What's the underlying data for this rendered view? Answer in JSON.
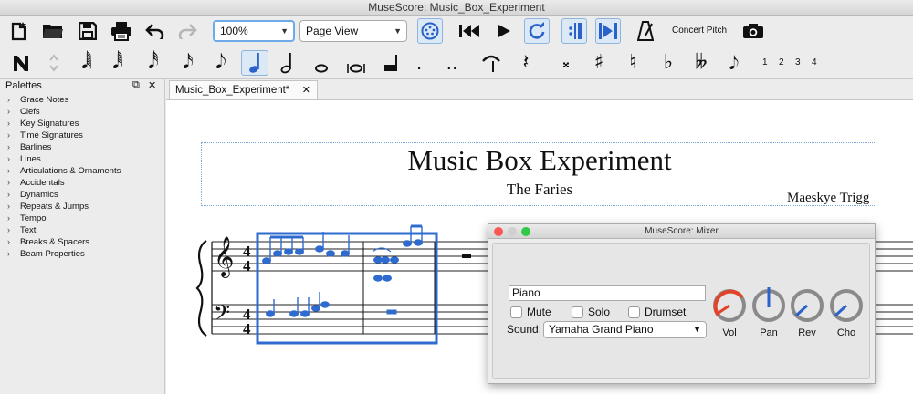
{
  "window": {
    "title": "MuseScore: Music_Box_Experiment"
  },
  "toolbar": {
    "zoom_value": "100%",
    "view_mode": "Page View",
    "concert_pitch_label": "Concert Pitch"
  },
  "note_input": {
    "rest": "𝄽",
    "dot": ".",
    "double_dot": "..",
    "voices": [
      "1",
      "2",
      "3",
      "4"
    ]
  },
  "palettes": {
    "header": "Palettes",
    "float_btn": "⧉",
    "close_btn": "✕",
    "chevron": "›",
    "items": [
      "Grace Notes",
      "Clefs",
      "Key Signatures",
      "Time Signatures",
      "Barlines",
      "Lines",
      "Articulations & Ornaments",
      "Accidentals",
      "Dynamics",
      "Repeats & Jumps",
      "Tempo",
      "Text",
      "Breaks & Spacers",
      "Beam Properties"
    ]
  },
  "document": {
    "tab_label": "Music_Box_Experiment*",
    "tab_close": "✕",
    "score_title": "Music Box Experiment",
    "subtitle": "The Faries",
    "composer": "Maeskye Trigg",
    "time_signature": {
      "top": "4",
      "bottom": "4"
    }
  },
  "mixer": {
    "title": "MuseScore: Mixer",
    "part_name": "Piano",
    "mute_label": "Mute",
    "solo_label": "Solo",
    "drumset_label": "Drumset",
    "sound_label": "Sound:",
    "sound_value": "Yamaha Grand Piano",
    "knobs": [
      {
        "label": "Vol",
        "color": "#e0452b"
      },
      {
        "label": "Pan",
        "color": "#2a62c9"
      },
      {
        "label": "Rev",
        "color": "#2a62c9"
      },
      {
        "label": "Cho",
        "color": "#2a62c9"
      }
    ]
  },
  "colors": {
    "selection": "#2f6bcf",
    "accent": "#2a62c9",
    "vol_knob": "#e0452b"
  }
}
